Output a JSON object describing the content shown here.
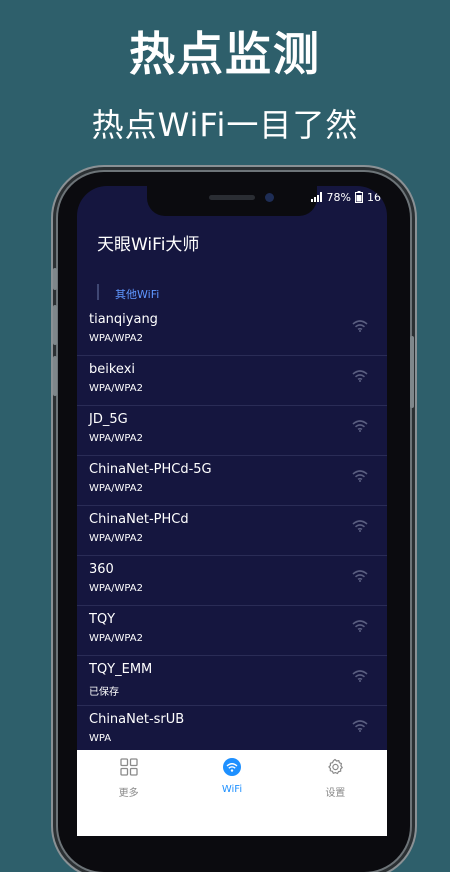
{
  "promo": {
    "title": "热点监测",
    "subtitle": "热点WiFi一目了然"
  },
  "status": {
    "battery": "78%",
    "clock": "16"
  },
  "app": {
    "title": "天眼WiFi大师",
    "section": "其他WiFi"
  },
  "networks": [
    {
      "name": "tianqiyang",
      "security": "WPA/WPA2"
    },
    {
      "name": "beikexi",
      "security": "WPA/WPA2"
    },
    {
      "name": "JD_5G",
      "security": "WPA/WPA2"
    },
    {
      "name": "ChinaNet-PHCd-5G",
      "security": "WPA/WPA2"
    },
    {
      "name": "ChinaNet-PHCd",
      "security": "WPA/WPA2"
    },
    {
      "name": "360",
      "security": "WPA/WPA2"
    },
    {
      "name": "TQY",
      "security": "WPA/WPA2"
    },
    {
      "name": "TQY_EMM",
      "security": "已保存"
    },
    {
      "name": "ChinaNet-srUB",
      "security": "WPA"
    }
  ],
  "nav": [
    {
      "label": "更多",
      "icon": "grid-icon",
      "active": false
    },
    {
      "label": "WiFi",
      "icon": "wifi-icon",
      "active": true
    },
    {
      "label": "设置",
      "icon": "gear-icon",
      "active": false
    }
  ],
  "colors": {
    "background": "#2e5f6b",
    "screen": "#15163f",
    "accent": "#1e90ff",
    "section": "#5f96ff"
  }
}
